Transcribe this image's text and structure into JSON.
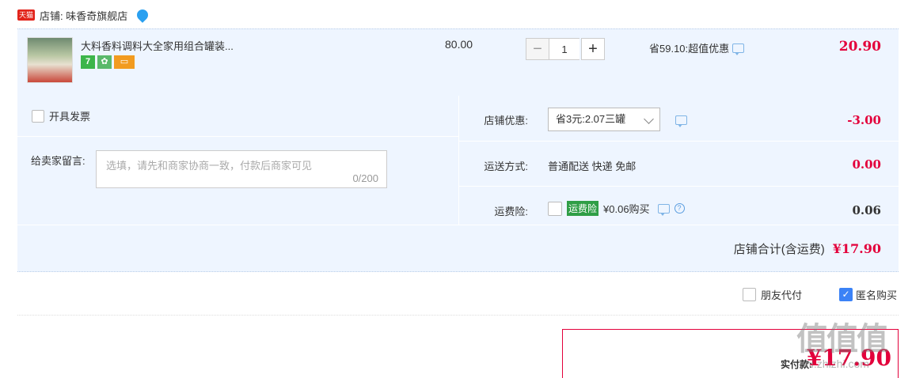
{
  "shop": {
    "badge": "天猫",
    "label": "店铺: 味香奇旗舰店"
  },
  "item": {
    "title": "大料香料调料大全家用组合罐装...",
    "badge1": "7",
    "unit_price": "80.00",
    "quantity": "1",
    "qty_minus": "−",
    "qty_plus": "+",
    "promo": "省59.10:超值优惠",
    "total": "20.90"
  },
  "options": {
    "invoice_label": "开具发票",
    "message_label": "给卖家留言:",
    "message_placeholder": "选填，请先和商家协商一致，付款后商家可见",
    "message_counter": "0/200",
    "store_discount_label": "店铺优惠:",
    "store_discount_selected": "省3元:2.07三罐",
    "store_discount_amount": "-3.00",
    "shipping_label": "运送方式:",
    "shipping_value": "普通配送 快递 免邮",
    "shipping_amount": "0.00",
    "insurance_label": "运费险:",
    "insurance_tag": "运费险",
    "insurance_price": "¥0.06购买",
    "insurance_amount": "0.06",
    "shop_total_label": "店铺合计(含运费)",
    "shop_total_value": "¥17.90"
  },
  "footer": {
    "friend_pay": "朋友代付",
    "anonymous": "匿名购买",
    "pay_label": "实付款:",
    "pay_amount": "¥17.90",
    "watermark": "值值值",
    "watermark_url": "zhi.zhizhi.com"
  },
  "colors": {
    "price_red": "#e3003b",
    "row_bg": "#eef5ff",
    "check_blue": "#3b82f6"
  }
}
